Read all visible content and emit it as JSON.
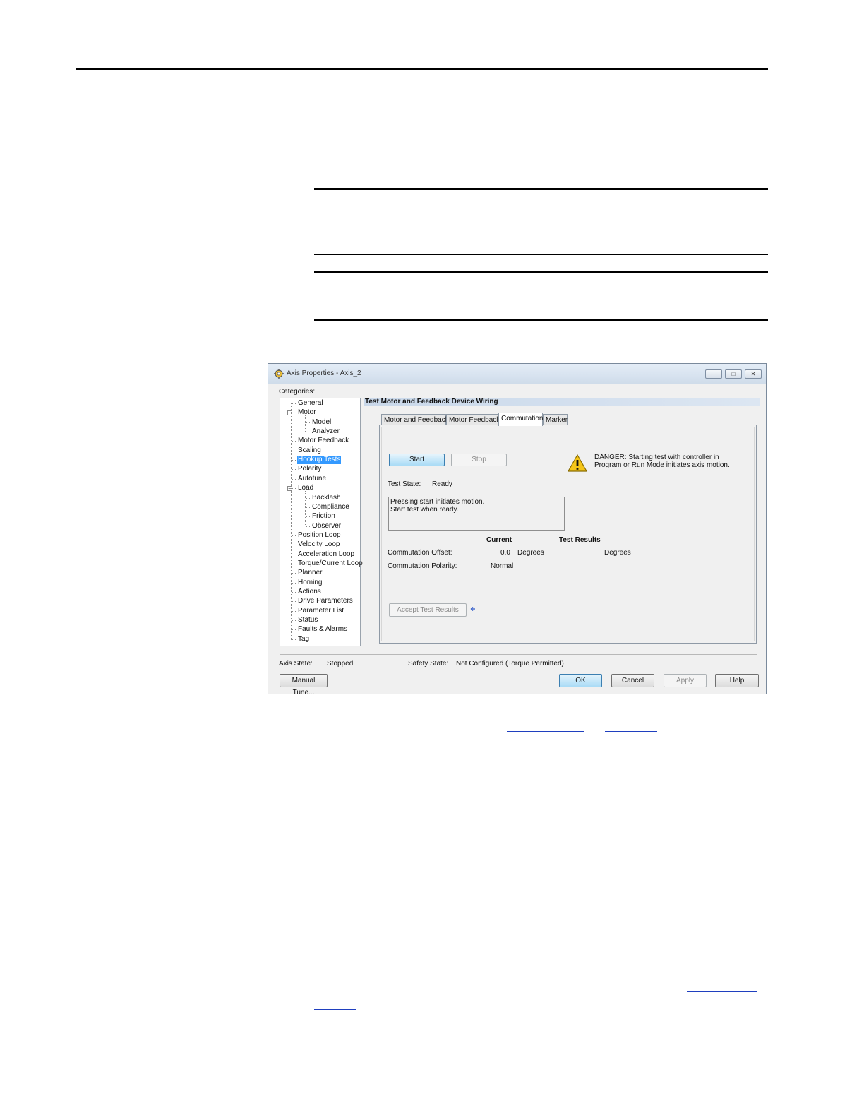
{
  "window": {
    "title": "Axis Properties - Axis_2",
    "minimize_glyph": "−",
    "maximize_glyph": "□",
    "close_glyph": "✕"
  },
  "categories_label": "Categories:",
  "tree": [
    {
      "label": "General",
      "level": 1
    },
    {
      "label": "Motor",
      "level": 1,
      "expanded": true
    },
    {
      "label": "Model",
      "level": 2
    },
    {
      "label": "Analyzer",
      "level": 2
    },
    {
      "label": "Motor Feedback",
      "level": 1
    },
    {
      "label": "Scaling",
      "level": 1
    },
    {
      "label": "Hookup Tests",
      "level": 1,
      "selected": true
    },
    {
      "label": "Polarity",
      "level": 1
    },
    {
      "label": "Autotune",
      "level": 1
    },
    {
      "label": "Load",
      "level": 1,
      "expanded": true
    },
    {
      "label": "Backlash",
      "level": 2
    },
    {
      "label": "Compliance",
      "level": 2
    },
    {
      "label": "Friction",
      "level": 2
    },
    {
      "label": "Observer",
      "level": 2
    },
    {
      "label": "Position Loop",
      "level": 1
    },
    {
      "label": "Velocity Loop",
      "level": 1
    },
    {
      "label": "Acceleration Loop",
      "level": 1
    },
    {
      "label": "Torque/Current Loop",
      "level": 1
    },
    {
      "label": "Planner",
      "level": 1
    },
    {
      "label": "Homing",
      "level": 1
    },
    {
      "label": "Actions",
      "level": 1
    },
    {
      "label": "Drive Parameters",
      "level": 1
    },
    {
      "label": "Parameter List",
      "level": 1
    },
    {
      "label": "Status",
      "level": 1
    },
    {
      "label": "Faults & Alarms",
      "level": 1
    },
    {
      "label": "Tag",
      "level": 1
    }
  ],
  "section_title": "Test Motor and Feedback Device Wiring",
  "tabs": [
    {
      "label": "Motor and Feedback",
      "active": false
    },
    {
      "label": "Motor Feedback",
      "active": false
    },
    {
      "label": "Commutation",
      "active": true
    },
    {
      "label": "Marker",
      "active": false
    }
  ],
  "buttons": {
    "start": "Start",
    "stop": "Stop",
    "accept": "Accept Test Results",
    "manual_tune": "Manual Tune...",
    "ok": "OK",
    "cancel": "Cancel",
    "apply": "Apply",
    "help": "Help"
  },
  "danger": {
    "line1": "DANGER: Starting test with controller in",
    "line2": "Program or Run Mode initiates axis motion."
  },
  "test_state": {
    "label": "Test State:",
    "value": "Ready"
  },
  "message": {
    "line1": "Pressing start initiates motion.",
    "line2": "Start test when ready."
  },
  "results": {
    "current_header": "Current",
    "test_results_header": "Test Results",
    "offset_label": "Commutation Offset:",
    "offset_current": "0.0",
    "offset_unit": "Degrees",
    "offset_result_unit": "Degrees",
    "polarity_label": "Commutation Polarity:",
    "polarity_current": "Normal"
  },
  "footer": {
    "axis_state_label": "Axis State:",
    "axis_state_value": "Stopped",
    "safety_state_label": "Safety State:",
    "safety_state_value": "Not Configured (Torque Permitted)"
  },
  "colors": {
    "selection": "#3399ff",
    "primary_button": "#a9dbf6",
    "header_band": "#c9d8ea",
    "warning": "#f5c518"
  }
}
